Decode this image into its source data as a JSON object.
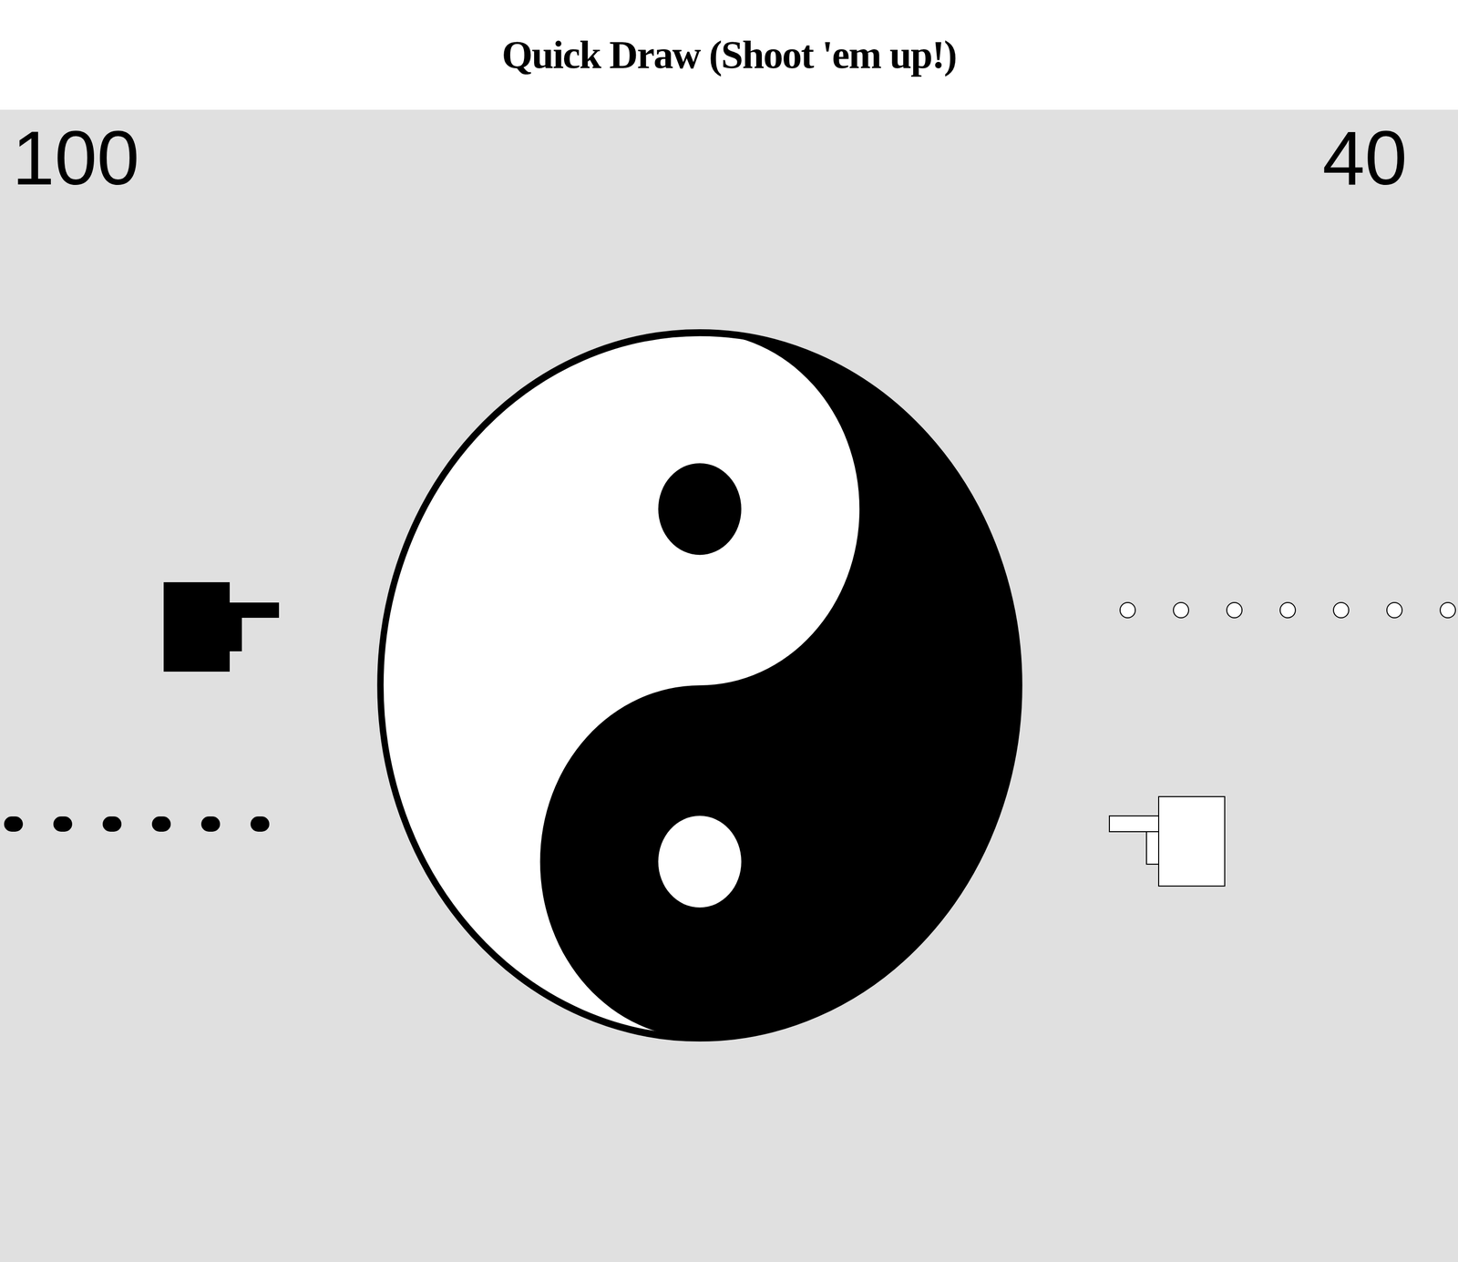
{
  "window": {
    "title": "Quick Draw (Shoot 'em up!)"
  },
  "players": [
    {
      "side": "left",
      "score": "100",
      "color": "#000000",
      "ammo": 6
    },
    {
      "side": "right",
      "score": "40",
      "color": "#ffffff",
      "ammo": 7
    }
  ]
}
